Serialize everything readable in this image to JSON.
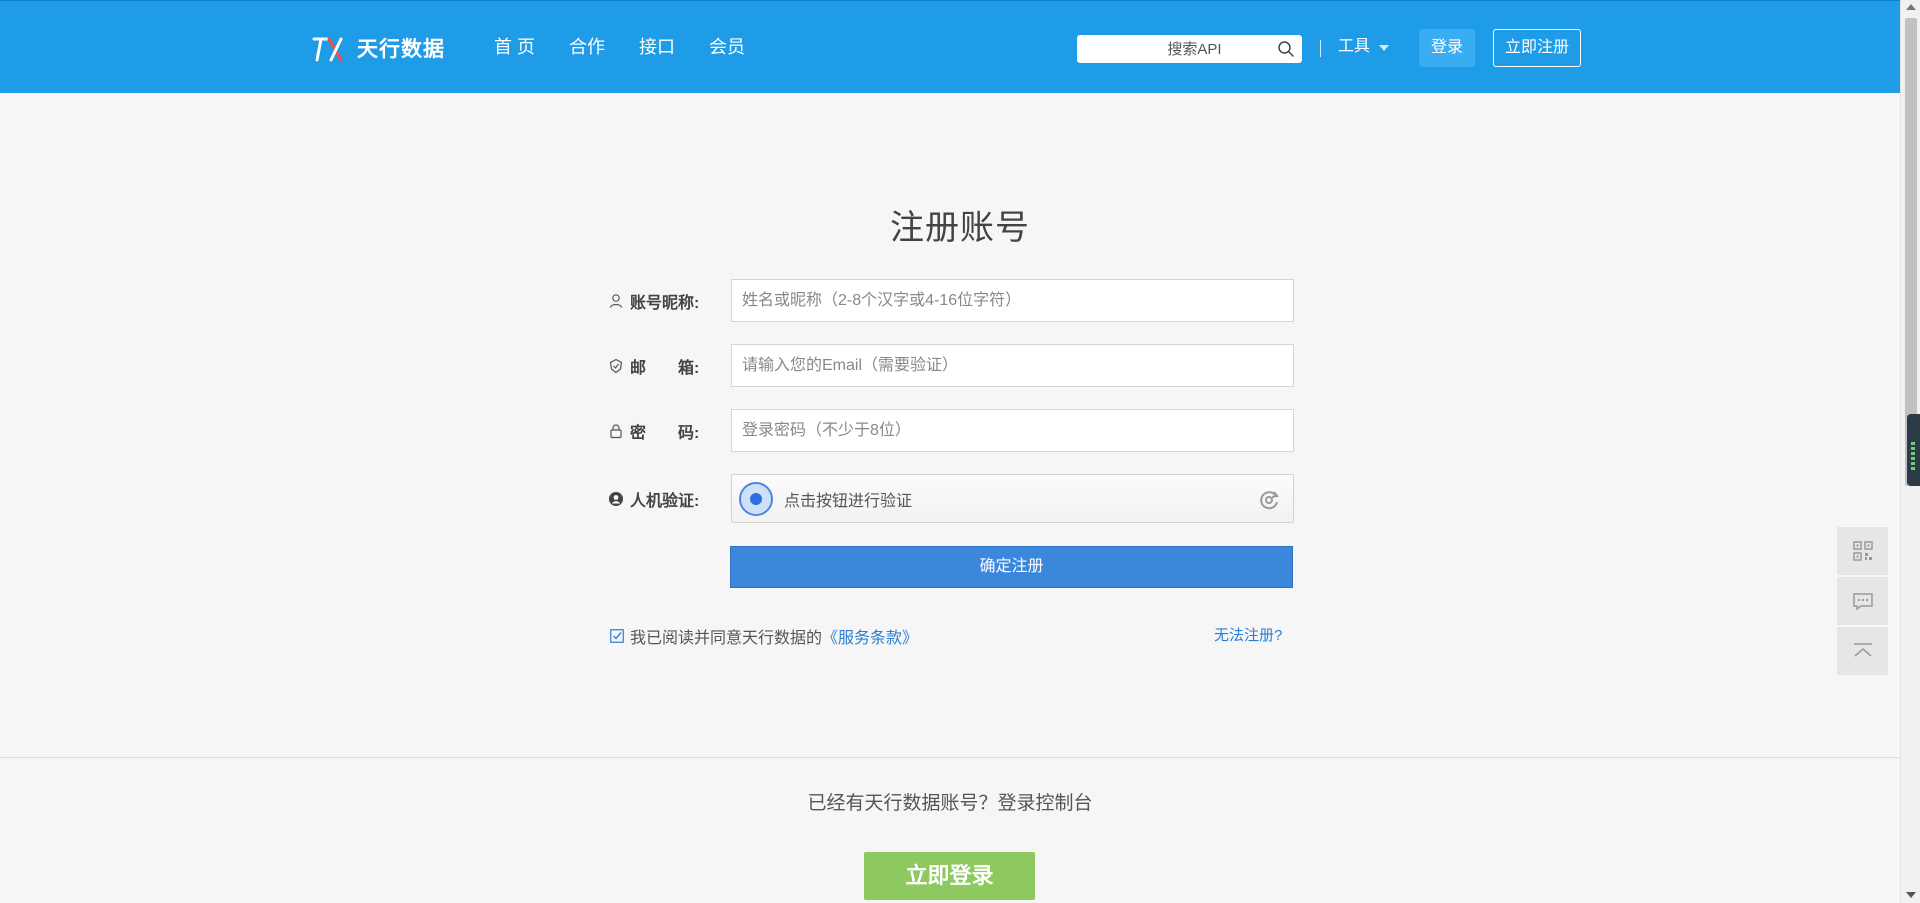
{
  "header": {
    "logo_text": "天行数据",
    "nav": [
      {
        "label": "首 页"
      },
      {
        "label": "合作"
      },
      {
        "label": "接口"
      },
      {
        "label": "会员"
      }
    ],
    "search_placeholder": "搜索API",
    "tools_label": "工具",
    "login_label": "登录",
    "register_label": "立即注册",
    "bg_color": "#1e9ce8"
  },
  "form": {
    "title": "注册账号",
    "nickname_label": "账号昵称:",
    "nickname_placeholder": "姓名或昵称（2-8个汉字或4-16位字符）",
    "email_label": "邮　　箱:",
    "email_placeholder": "请输入您的Email（需要验证）",
    "password_label": "密　　码:",
    "password_placeholder": "登录密码（不少于8位）",
    "captcha_label": "人机验证:",
    "captcha_text": "点击按钮进行验证",
    "submit_label": "确定注册",
    "agree_text": "我已阅读并同意天行数据的",
    "terms_link": "《服务条款》",
    "cannot_register": "无法注册?",
    "submit_color": "#3a87dc"
  },
  "footer": {
    "have_account": "已经有天行数据账号？登录控制台",
    "login_now": "立即登录",
    "login_now_color": "#8ec95f"
  },
  "side_tools": [
    {
      "icon": "qrcode-icon"
    },
    {
      "icon": "chat-icon"
    },
    {
      "icon": "back-to-top-icon"
    }
  ]
}
